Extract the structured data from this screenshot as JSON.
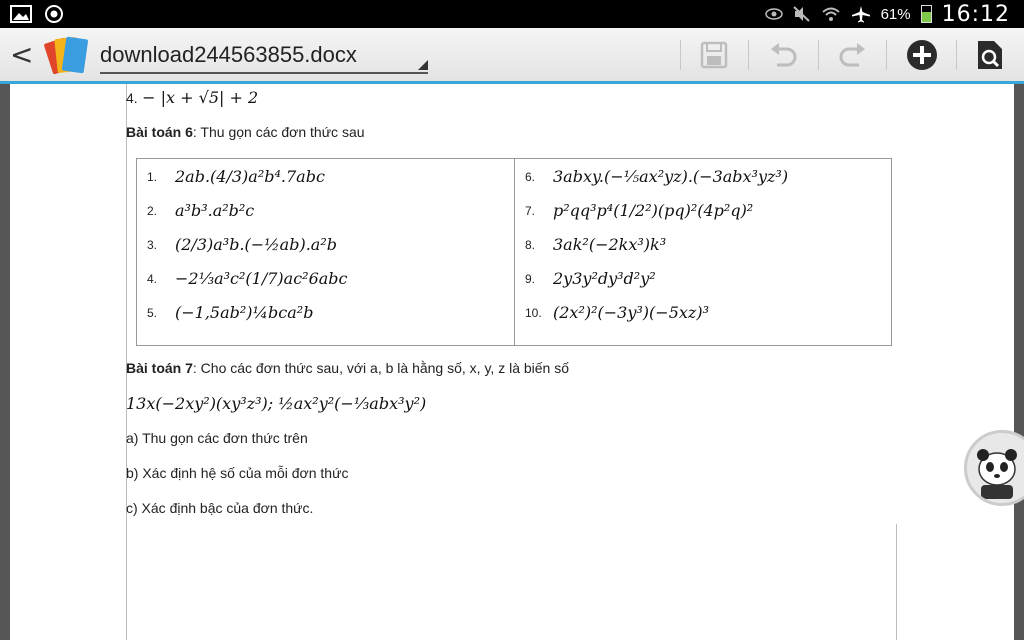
{
  "status_bar": {
    "battery": "61%",
    "battery_level": 0.61,
    "time": "16:12"
  },
  "action_bar": {
    "back": "<",
    "file_name": "download244563855.docx"
  },
  "document": {
    "line4_num": "4.",
    "line4_expr": "− |x + √5| + 2",
    "p6_heading": "Bài toán 6",
    "p6_text": ": Thu gọn các đơn thức sau",
    "table_left": [
      {
        "num": "1.",
        "expr": "2ab.(4/3)a²b⁴.7abc"
      },
      {
        "num": "2.",
        "expr": "a³b³.a²b²c"
      },
      {
        "num": "3.",
        "expr": "(2/3)a³b.(−½ab).a²b"
      },
      {
        "num": "4.",
        "expr": "−2⅓a³c²(1/7)ac²6abc"
      },
      {
        "num": "5.",
        "expr": "(−1,5ab²)¼bca²b"
      }
    ],
    "table_right": [
      {
        "num": "6.",
        "expr": "3abxy.(−⅕ax²yz).(−3abx³yz³)"
      },
      {
        "num": "7.",
        "expr": "p²qq³p⁴(1/2²)(pq)²(4p²q)²"
      },
      {
        "num": "8.",
        "expr": "3ak²(−2kx³)k³"
      },
      {
        "num": "9.",
        "expr": "2y3y²dy³d²y²"
      },
      {
        "num": "10.",
        "expr": "(2x²)²(−3y³)(−5xz)³"
      }
    ],
    "p7_heading": "Bài toán 7",
    "p7_text": ": Cho các đơn thức sau, với a, b là hằng số, x, y, z là biến số",
    "p7_expr": "13x(−2xy²)(xy³z³); ½ax²y²(−⅓abx³y²)",
    "qa": "a) Thu gọn các đơn thức trên",
    "qb": "b) Xác định hệ số của mỗi đơn thức",
    "qc": "c) Xác định bậc của đơn thức."
  }
}
